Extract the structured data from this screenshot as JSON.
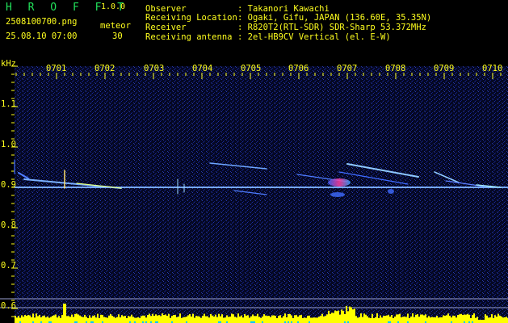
{
  "app": {
    "name": "H R O F F T",
    "version": "1.0.0",
    "filename": "2508100700.png",
    "meteor_label": "meteor",
    "datetime": "25.08.10 07:00",
    "meteor_count": "30"
  },
  "info": [
    {
      "label": "Observer",
      "value": ": Takanori Kawachi"
    },
    {
      "label": "Receiving Location",
      "value": ": Ogaki, Gifu, JAPAN (136.60E, 35.35N)"
    },
    {
      "label": "Receiver",
      "value": ": R820T2(RTL-SDR) SDR-Sharp 53.372MHz"
    },
    {
      "label": "Receiving antenna",
      "value": ": 2el-HB9CV Vertical (el. E-W)"
    }
  ],
  "axis": {
    "unit": "kHz",
    "y_ticks": [
      "1.1",
      "1.0",
      "0.9",
      "0.8",
      "0.7",
      "0.6"
    ],
    "x_ticks": [
      "0701",
      "0702",
      "0703",
      "0704",
      "0705",
      "0706",
      "0707",
      "0708",
      "0709",
      "0710"
    ]
  },
  "colors": {
    "background": "#000000",
    "text_green": "#21e05a",
    "text_yellow": "#ffff1e",
    "spectrum_blue": "#1a2aa0",
    "carrier": "#8fe0ff",
    "level_bar": "#ffff00",
    "level_base": "#00c8ff"
  }
}
